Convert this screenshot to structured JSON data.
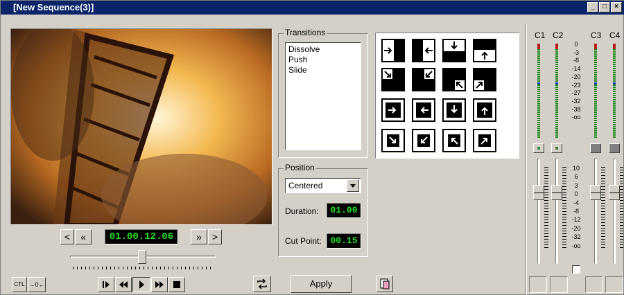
{
  "window": {
    "title": "[New Sequence(3)]",
    "min": "_",
    "max": "□",
    "close": "×"
  },
  "timecode": "01.00.12.06",
  "nav": {
    "prev": "<",
    "rewind": "«",
    "ffwd": "»",
    "next": ">"
  },
  "transitions": {
    "label": "Transitions",
    "items": [
      "Dissolve",
      "Push",
      "Slide"
    ]
  },
  "position": {
    "label": "Position",
    "selected": "Centered",
    "duration_label": "Duration:",
    "duration": "01.00",
    "cut_label": "Cut Point:",
    "cut": "00.15"
  },
  "apply": "Apply",
  "ctl": "CTL",
  "audio": {
    "channels": [
      "C1",
      "C2",
      "C3",
      "C4"
    ],
    "meter_scale": [
      "0",
      "-3",
      "-8",
      "-14",
      "-20",
      "-23",
      "-27",
      "-32",
      "-38",
      "-oo"
    ],
    "fader_scale": [
      "10",
      "6",
      "3",
      "0",
      "-4",
      "-8",
      "-12",
      "-20",
      "-32",
      "-oo"
    ]
  },
  "icons": {
    "transport": [
      "step-frame-icon",
      "rewind-icon",
      "play-icon",
      "fast-forward-icon",
      "stop-icon"
    ],
    "loop": "loop-icon",
    "edit": "edit-icon"
  }
}
